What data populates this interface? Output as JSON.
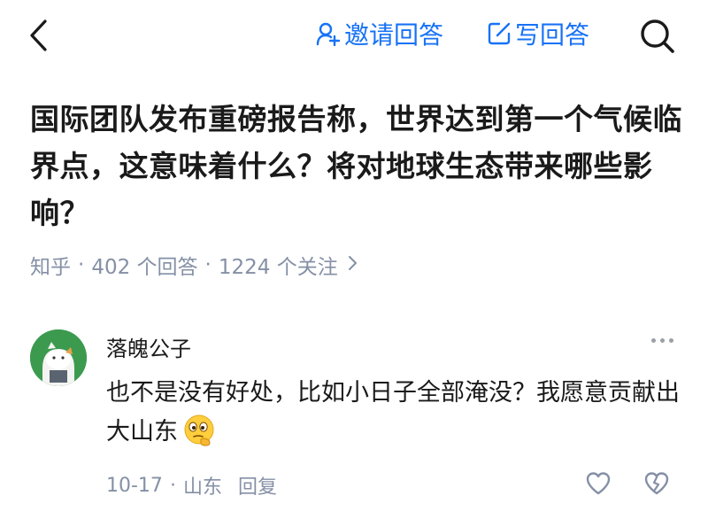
{
  "topbar": {
    "invite_label": "邀请回答",
    "write_label": "写回答",
    "accent_color": "#1772f6"
  },
  "question": {
    "title": "国际团队发布重磅报告称，世界达到第一个气候临界点，这意味着什么？将对地球生态带来哪些影响？",
    "source": "知乎",
    "separator": "·",
    "answers": "402 个回答",
    "followers": "1224 个关注"
  },
  "comment": {
    "author": "落魄公子",
    "text": "也不是没有好处，比如小日子全部淹没？我愿意贡献出大山东",
    "emoji": "thinking-emoji",
    "date": "10-17",
    "separator": "·",
    "location": "山东",
    "reply_label": "回复"
  },
  "icons": {
    "back": "chevron-left-icon",
    "invite": "add-person-icon",
    "write": "edit-icon",
    "search": "search-icon",
    "more": "more-dots-icon",
    "like": "heart-icon",
    "dislike": "broken-heart-icon"
  }
}
